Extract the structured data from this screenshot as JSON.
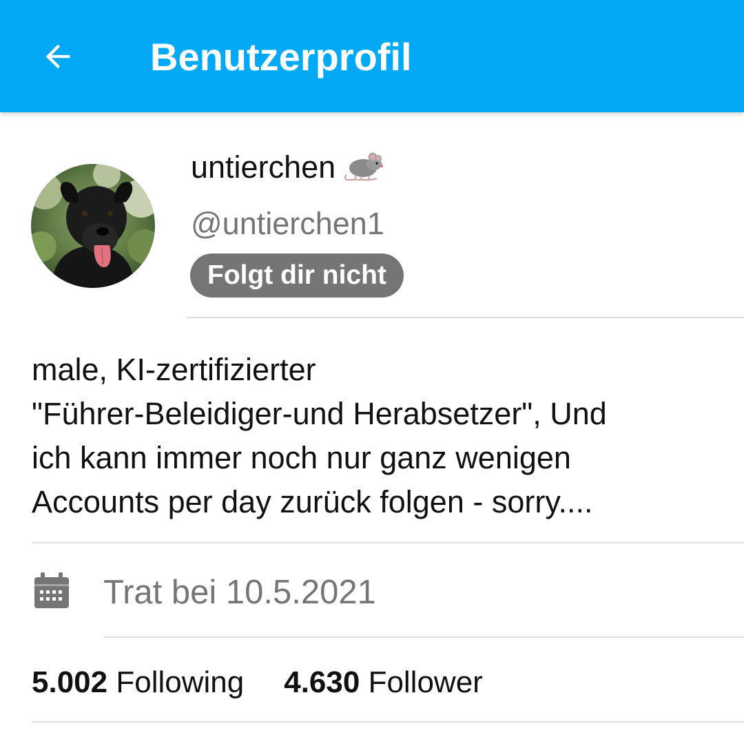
{
  "header": {
    "title": "Benutzerprofil",
    "back_icon": "arrow-back-icon",
    "background_color": "#03A9F4"
  },
  "profile": {
    "display_name": "untierchen",
    "name_emoji": "mouse-emoji-icon",
    "handle": "@untierchen1",
    "follow_status": "Folgt dir nicht",
    "avatar": "avatar-photo-dog"
  },
  "bio": {
    "lines": [
      "male,  KI-zertifizierter",
      "\"Führer-Beleidiger-und Herabsetzer\", Und",
      "ich kann immer noch nur ganz wenigen",
      "Accounts per day zurück folgen - sorry...."
    ]
  },
  "joined": {
    "icon": "calendar-icon",
    "text": "Trat bei 10.5.2021"
  },
  "stats": {
    "following_count": "5.002",
    "following_label": "Following",
    "follower_count": "4.630",
    "follower_label": "Follower"
  }
}
